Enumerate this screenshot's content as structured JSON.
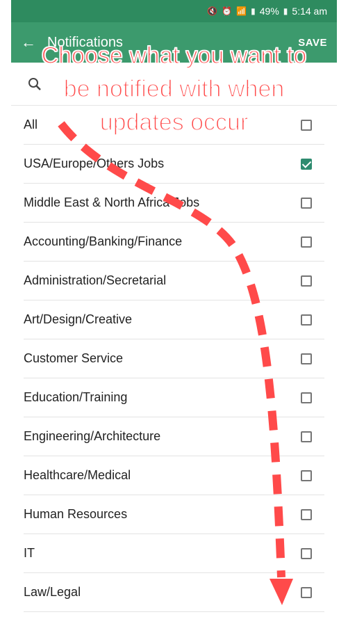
{
  "status_bar": {
    "battery": "49%",
    "time": "5:14 am"
  },
  "appbar": {
    "title": "Notifications",
    "save_label": "SAVE"
  },
  "search": {
    "placeholder": ""
  },
  "overlay": {
    "line1": "Choose what you want to",
    "line2": "be notified with when",
    "line3": "updates occur"
  },
  "categories": [
    {
      "label": "All",
      "checked": false
    },
    {
      "label": "USA/Europe/Others Jobs",
      "checked": true
    },
    {
      "label": "Middle East & North Africa Jobs",
      "checked": false
    },
    {
      "label": "Accounting/Banking/Finance",
      "checked": false
    },
    {
      "label": "Administration/Secretarial",
      "checked": false
    },
    {
      "label": "Art/Design/Creative",
      "checked": false
    },
    {
      "label": "Customer Service",
      "checked": false
    },
    {
      "label": "Education/Training",
      "checked": false
    },
    {
      "label": "Engineering/Architecture",
      "checked": false
    },
    {
      "label": "Healthcare/Medical",
      "checked": false
    },
    {
      "label": "Human Resources",
      "checked": false
    },
    {
      "label": "IT",
      "checked": false
    },
    {
      "label": "Law/Legal",
      "checked": false
    }
  ],
  "colors": {
    "statusbar": "#2e8b5f",
    "appbar": "#3c9a6d",
    "checkbox_checked": "#2e8b6f",
    "annotation": "#ff4a4a"
  }
}
